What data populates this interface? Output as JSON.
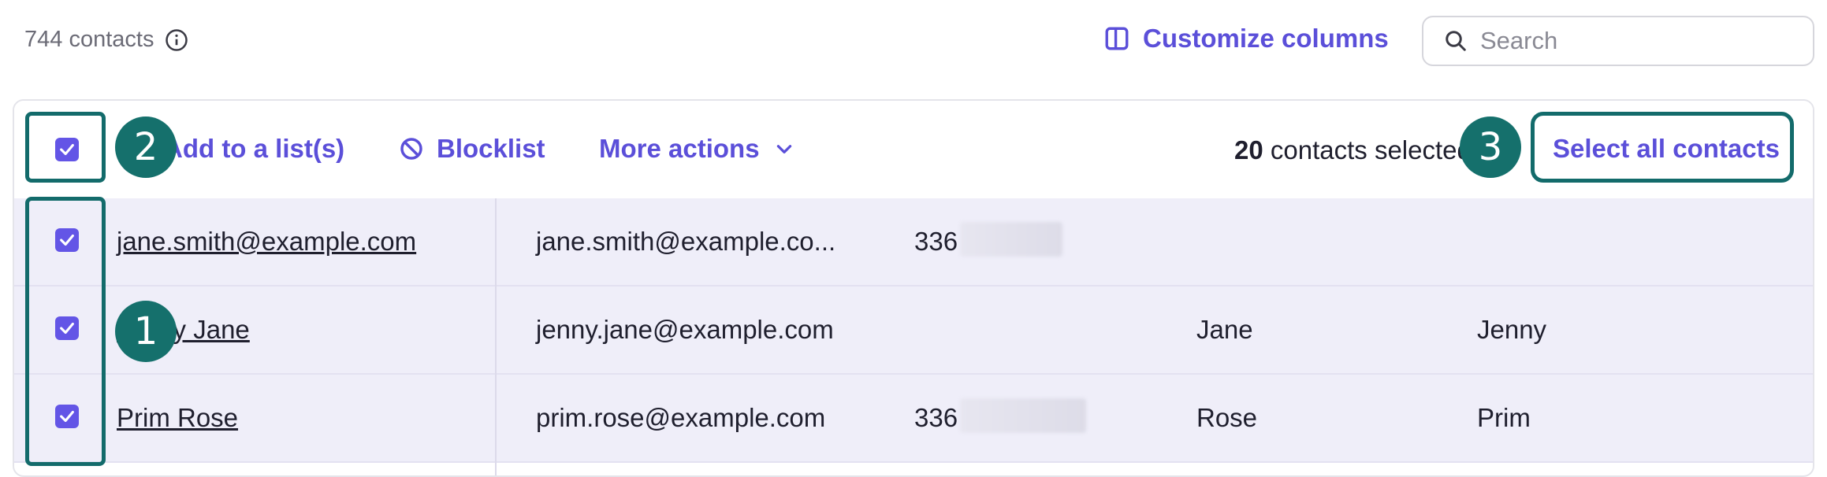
{
  "header": {
    "contact_count": "744 contacts",
    "customize_label": "Customize columns",
    "search_placeholder": "Search"
  },
  "actions": {
    "add_to_list": "Add to a list(s)",
    "blocklist": "Blocklist",
    "more_actions": "More actions",
    "selected_count": "20",
    "selected_suffix": " contacts selected",
    "select_all": "Select all contacts"
  },
  "rows": [
    {
      "name": "jane.smith@example.com",
      "email": "jane.smith@example.co...",
      "phone": "336",
      "last_name": "",
      "first_name": "",
      "checked": true
    },
    {
      "name": "Jenny Jane",
      "email": "jenny.jane@example.com",
      "phone": "",
      "last_name": "Jane",
      "first_name": "Jenny",
      "checked": true
    },
    {
      "name": "Prim Rose",
      "email": "prim.rose@example.com",
      "phone": "336",
      "last_name": "Rose",
      "first_name": "Prim",
      "checked": true
    }
  ],
  "annotations": {
    "badge1": "1",
    "badge2": "2",
    "badge3": "3"
  },
  "colors": {
    "accent": "#5b4fd9",
    "checkbox": "#6355e6",
    "annotation": "#136b6b",
    "row_bg": "#efeef9"
  }
}
